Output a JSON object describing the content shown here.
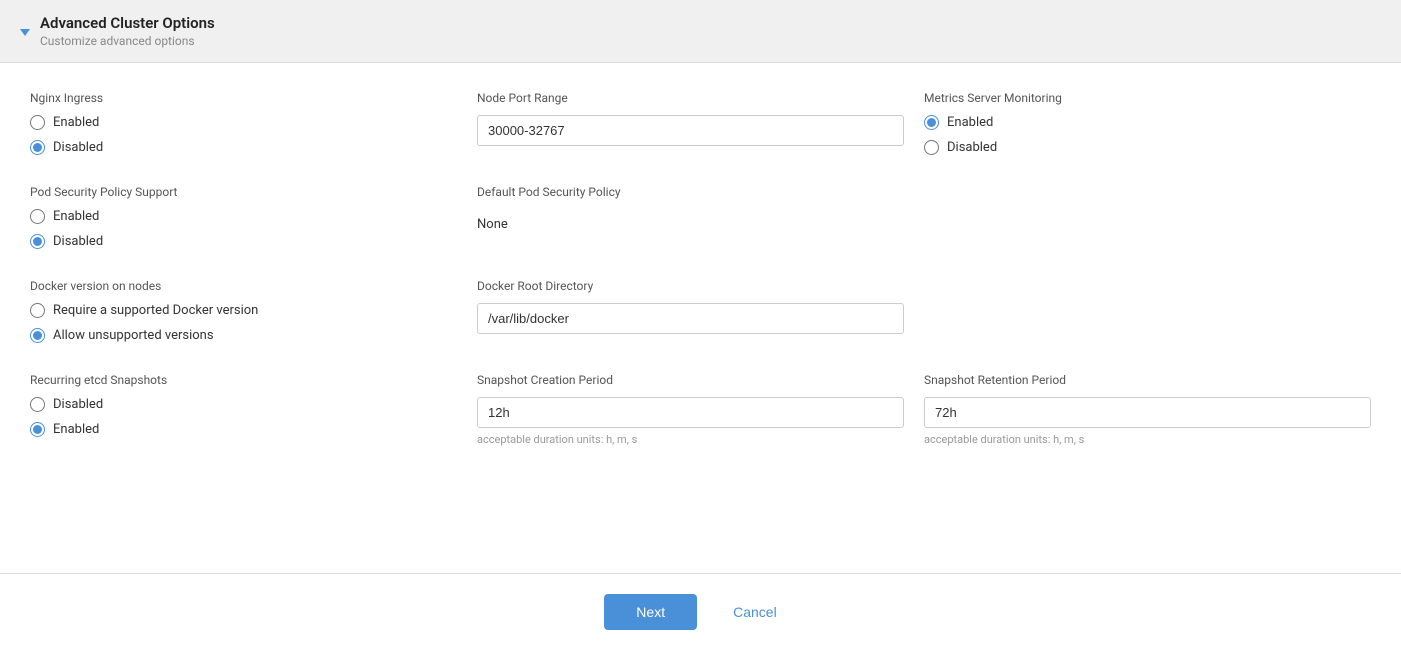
{
  "header": {
    "title": "Advanced Cluster Options",
    "subtitle": "Customize advanced options"
  },
  "rows": [
    {
      "cols": [
        {
          "id": "nginx-ingress",
          "label": "Nginx Ingress",
          "type": "radio",
          "options": [
            "Enabled",
            "Disabled"
          ],
          "selected": "Disabled"
        },
        {
          "id": "node-port-range",
          "label": "Node Port Range",
          "type": "input",
          "value": "30000-32767"
        },
        {
          "id": "metrics-server",
          "label": "Metrics Server Monitoring",
          "type": "radio",
          "options": [
            "Enabled",
            "Disabled"
          ],
          "selected": "Enabled"
        }
      ]
    },
    {
      "cols": [
        {
          "id": "pod-security-policy",
          "label": "Pod Security Policy Support",
          "type": "radio",
          "options": [
            "Enabled",
            "Disabled"
          ],
          "selected": "Disabled"
        },
        {
          "id": "default-pod-security-policy",
          "label": "Default Pod Security Policy",
          "type": "static",
          "value": "None"
        },
        {
          "id": "empty1",
          "type": "empty"
        }
      ]
    },
    {
      "cols": [
        {
          "id": "docker-version",
          "label": "Docker version on nodes",
          "type": "radio",
          "options": [
            "Require a supported Docker version",
            "Allow unsupported versions"
          ],
          "selected": "Allow unsupported versions"
        },
        {
          "id": "docker-root-dir",
          "label": "Docker Root Directory",
          "type": "input",
          "value": "/var/lib/docker"
        },
        {
          "id": "empty2",
          "type": "empty"
        }
      ]
    },
    {
      "cols": [
        {
          "id": "recurring-etcd",
          "label": "Recurring etcd Snapshots",
          "type": "radio",
          "options": [
            "Disabled",
            "Enabled"
          ],
          "selected": "Enabled"
        },
        {
          "id": "snapshot-creation",
          "label": "Snapshot Creation Period",
          "type": "input",
          "value": "12h",
          "hint": "acceptable duration units: h, m, s"
        },
        {
          "id": "snapshot-retention",
          "label": "Snapshot Retention Period",
          "type": "input",
          "value": "72h",
          "hint": "acceptable duration units: h, m, s"
        }
      ]
    }
  ],
  "footer": {
    "next_label": "Next",
    "cancel_label": "Cancel"
  }
}
